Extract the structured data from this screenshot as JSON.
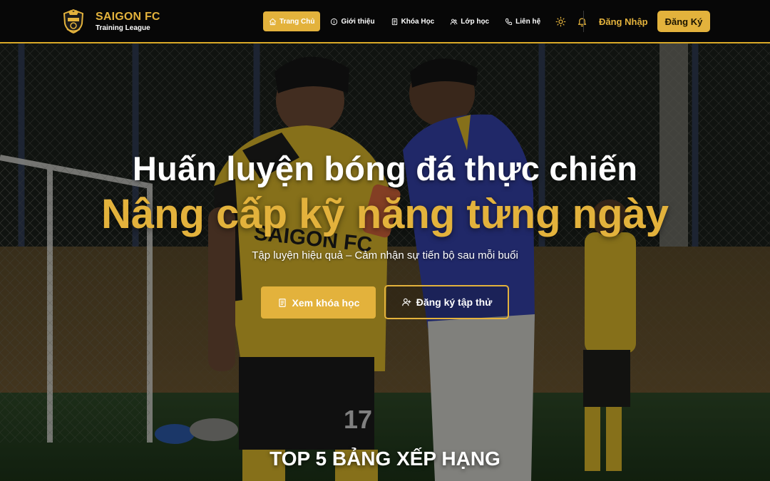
{
  "brand": {
    "name": "SAIGON FC",
    "subtitle": "Training League"
  },
  "nav": [
    {
      "label": "Trang Chủ",
      "icon": "home-icon",
      "active": true
    },
    {
      "label": "Giới thiệu",
      "icon": "info-icon",
      "active": false
    },
    {
      "label": "Khóa Học",
      "icon": "book-icon",
      "active": false
    },
    {
      "label": "Lớp học",
      "icon": "users-icon",
      "active": false
    },
    {
      "label": "Liên hệ",
      "icon": "phone-icon",
      "active": false
    }
  ],
  "nav_icons": [
    "sun-icon",
    "bell-icon"
  ],
  "auth": {
    "login_label": "Đăng Nhập",
    "register_label": "Đăng Ký"
  },
  "hero": {
    "headline": "Huấn luyện bóng đá thực chiến",
    "headline_accent": "Nâng cấp kỹ năng từng ngày",
    "subline": "Tập luyện hiệu quả – Cảm nhận sự tiến bộ sau mỗi buổi",
    "primary_cta": "Xem khóa học",
    "secondary_cta": "Đăng ký tập thử",
    "photo_text": {
      "jersey_brand": "SAIGON FC",
      "jersey_number": "17"
    }
  },
  "leaderboard": {
    "title": "TOP 5 BẢNG XẾP HẠNG"
  },
  "colors": {
    "accent": "#e3b23c",
    "navbar_bg": "#070707",
    "jersey_yellow": "#d8b52a",
    "shirt_blue": "#3442a8"
  }
}
